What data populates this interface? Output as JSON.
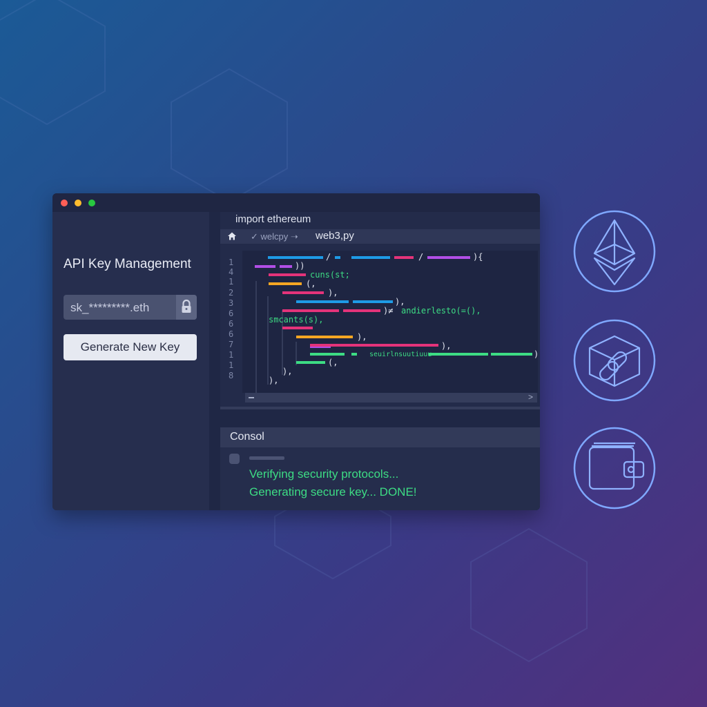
{
  "window": {
    "titlebar_controls": [
      "close",
      "minimize",
      "maximize"
    ]
  },
  "sidebar": {
    "title": "API Key Management",
    "key_field_value": "sk_*********.eth",
    "generate_button_label": "Generate New Key"
  },
  "editor": {
    "file_header": "import ethereum",
    "tabs": [
      {
        "label": "welcpy",
        "state": "inactive"
      },
      {
        "label": "web3,py",
        "state": "active"
      }
    ],
    "line_numbers": [
      "1",
      "4",
      "1",
      "2",
      "3",
      "6",
      "6",
      "6",
      "7",
      "1",
      "1",
      "8"
    ],
    "code_text": {
      "line1_suffix": "){",
      "line2_suffix": "))",
      "line3": "cuns(st;",
      "line4": "(,",
      "line5_suffix": "),",
      "line6_suffix": "),",
      "line7_mid": ")≠",
      "line7_text": "andierlesto(=(),",
      "line8": "smcants(s),",
      "line10_suffix": "),",
      "line11_suffix": "),",
      "line12_text": "seuirlnsuutiuuu",
      "line12_suffix": ")",
      "line13": "(,",
      "line14": "),",
      "line15": "),"
    }
  },
  "console": {
    "title": "Consol",
    "lines": [
      "Verifying security protocols...",
      "Generating secure key... DONE!"
    ]
  },
  "side_icons": [
    "ethereum-icon",
    "blockchain-link-icon",
    "wallet-icon"
  ],
  "colors": {
    "accent_green": "#3ddc84",
    "accent_blue": "#1e9be6",
    "accent_pink": "#e4337a",
    "accent_purple": "#b14ee6",
    "accent_orange": "#f5a623",
    "icon_outline": "#7fa8ff"
  }
}
